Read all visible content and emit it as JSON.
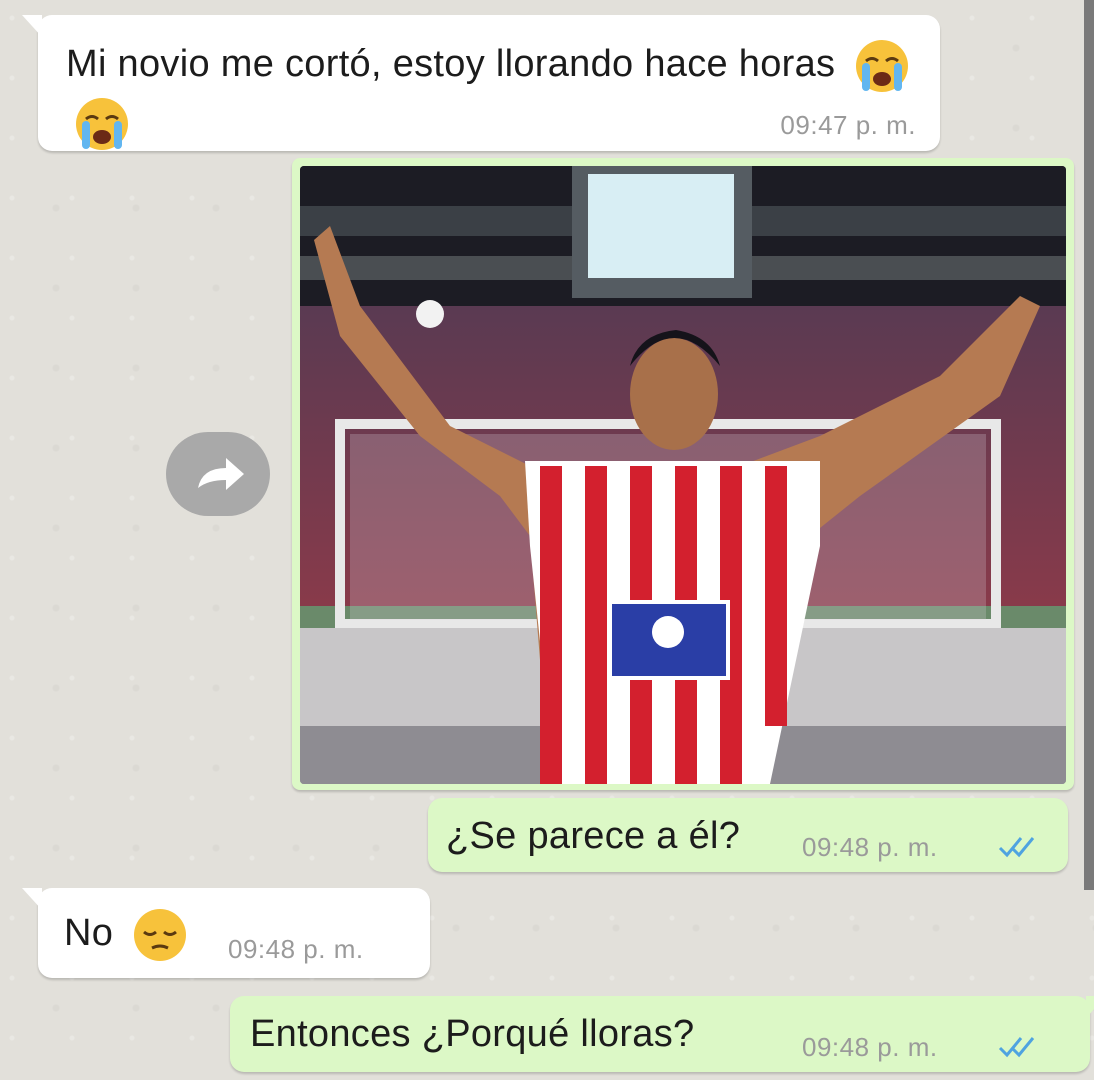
{
  "messages": [
    {
      "direction": "incoming",
      "text": "Mi novio me cortó, estoy llorando hace horas",
      "emojis": [
        "loudly-crying-face",
        "loudly-crying-face"
      ],
      "time": "09:47 p. m."
    },
    {
      "direction": "outgoing",
      "type": "image",
      "image_description": "football-player-celebrating-arms-raised"
    },
    {
      "direction": "outgoing",
      "text": "¿Se parece a él?",
      "time": "09:48 p. m.",
      "status": "read-double-check"
    },
    {
      "direction": "incoming",
      "text": "No",
      "emojis": [
        "pensive-face"
      ],
      "time": "09:48 p. m."
    },
    {
      "direction": "outgoing",
      "text": "Entonces ¿Porqué lloras?",
      "time": "09:48 p. m.",
      "status": "read-double-check"
    }
  ],
  "colors": {
    "incoming_bubble": "#ffffff",
    "outgoing_bubble": "#dcf8c6",
    "read_ticks": "#4fa3e0",
    "background": "#e2e0da"
  },
  "icons": {
    "forward": "forward-arrow-icon"
  }
}
